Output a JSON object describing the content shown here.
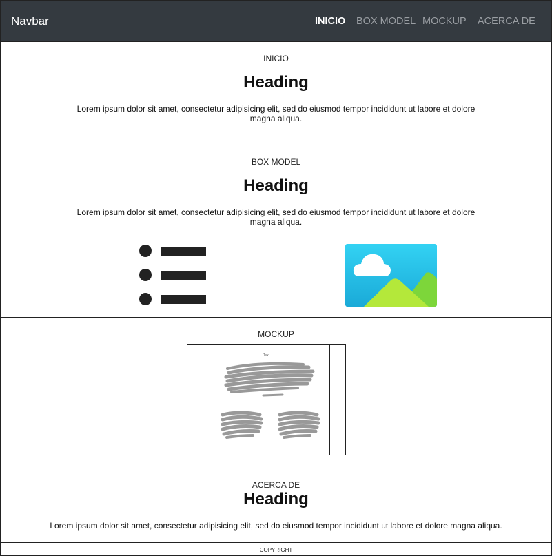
{
  "nav": {
    "brand": "Navbar",
    "links": [
      "INICIO",
      "BOX MODEL",
      "MOCKUP",
      "ACERCA DE"
    ]
  },
  "sections": [
    {
      "label": "INICIO",
      "heading": "Heading",
      "text_line1": "Lorem ipsum dolor sit amet, consectetur adipisicing elit, sed do eiusmod tempor incididunt ut labore et dolore",
      "text_line2": "magna aliqua."
    },
    {
      "label": "BOX MODEL",
      "heading": "Heading",
      "text_line1": "Lorem ipsum dolor sit amet, consectetur adipisicing elit, sed do eiusmod tempor incididunt ut labore et dolore",
      "text_line2": "magna aliqua."
    },
    {
      "label": "MOCKUP",
      "mockup_caption": "Text"
    },
    {
      "label": "ACERCA DE",
      "heading": "Heading",
      "text": "Lorem ipsum dolor sit amet, consectetur adipisicing elit, sed do eiusmod tempor incididunt ut labore et dolore magna aliqua."
    }
  ],
  "footer": {
    "text": "COPYRIGHT"
  },
  "icons": [
    "list-icon",
    "image-icon"
  ],
  "colors": {
    "navbar_bg": "#343a40",
    "nav_active": "#ffffff",
    "nav_inactive": "#9a9ea3"
  }
}
